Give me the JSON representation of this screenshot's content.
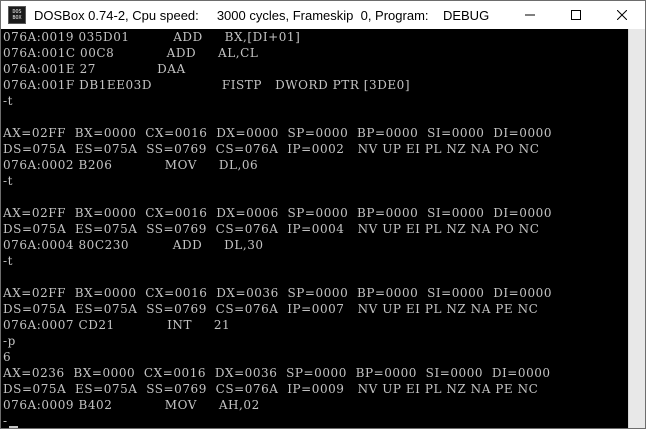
{
  "window": {
    "title": "DOSBox 0.74-2, Cpu speed:     3000 cycles, Frameskip  0, Program:    DEBUG",
    "icon_text_top": "DOS",
    "icon_text_bottom": "BOX",
    "controls": {
      "minimize_icon": "minimize-icon",
      "maximize_icon": "maximize-icon",
      "close_icon": "close-icon"
    }
  },
  "terminal": {
    "lines": [
      "076A:0019 035D01          ADD     BX,[DI+01]",
      "076A:001C 00C8            ADD     AL,CL",
      "076A:001E 27              DAA",
      "076A:001F DB1EE03D                FISTP   DWORD PTR [3DE0]",
      "-t",
      "",
      "AX=02FF  BX=0000  CX=0016  DX=0000  SP=0000  BP=0000  SI=0000  DI=0000",
      "DS=075A  ES=075A  SS=0769  CS=076A  IP=0002   NV UP EI PL NZ NA PO NC",
      "076A:0002 B206            MOV     DL,06",
      "-t",
      "",
      "AX=02FF  BX=0000  CX=0016  DX=0006  SP=0000  BP=0000  SI=0000  DI=0000",
      "DS=075A  ES=075A  SS=0769  CS=076A  IP=0004   NV UP EI PL NZ NA PO NC",
      "076A:0004 80C230          ADD     DL,30",
      "-t",
      "",
      "AX=02FF  BX=0000  CX=0016  DX=0036  SP=0000  BP=0000  SI=0000  DI=0000",
      "DS=075A  ES=075A  SS=0769  CS=076A  IP=0007   NV UP EI PL NZ NA PE NC",
      "076A:0007 CD21            INT     21",
      "-p",
      "6",
      "AX=0236  BX=0000  CX=0016  DX=0036  SP=0000  BP=0000  SI=0000  DI=0000",
      "DS=075A  ES=075A  SS=0769  CS=076A  IP=0009   NV UP EI PL NZ NA PE NC",
      "076A:0009 B402            MOV     AH,02",
      "-"
    ]
  }
}
